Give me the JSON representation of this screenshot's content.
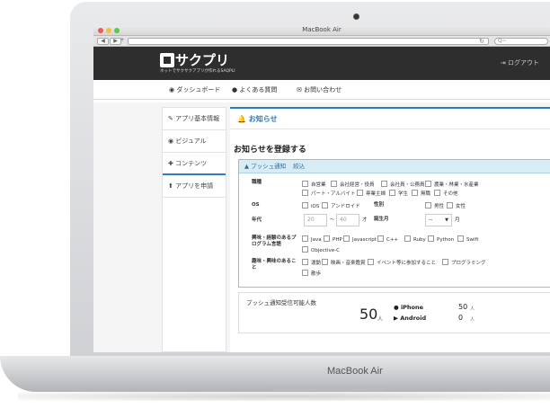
{
  "device": {
    "brand": "MacBook Air"
  },
  "browser": {
    "window_title": "MacBook Air",
    "back_label": "◀",
    "forward_label": "▶",
    "plus_label": "+",
    "reload_label": "↻",
    "search_placeholder": "Q~"
  },
  "header": {
    "logo_text": "サクプリ",
    "logo_sub": "ネットでサクサクアプリが作れるSAQPLI",
    "logout_label": "ログアウト"
  },
  "nav": {
    "items": [
      {
        "label": "ダッシュボード"
      },
      {
        "label": "よくある質問"
      },
      {
        "label": "お問い合わせ"
      }
    ]
  },
  "sidebar": {
    "items": [
      {
        "label": "アプリ基本情報"
      },
      {
        "label": "ビジュアル"
      },
      {
        "label": "コンテンツ"
      },
      {
        "label": "アプリを申請"
      }
    ]
  },
  "main": {
    "tab_label": "お知らせ",
    "page_title": "お知らせを登録する",
    "push": {
      "header_label": "プッシュ通知",
      "filter_label": "絞込",
      "job": {
        "label": "職種",
        "options": [
          "自営業",
          "会社経営・役員",
          "会社員・公務員",
          "農業・林業・水産業",
          "パート・アルバイト",
          "専業主婦",
          "学生",
          "無職",
          "その他"
        ]
      },
      "os": {
        "label": "OS",
        "options": [
          "iOS",
          "アンドロイド"
        ]
      },
      "gender": {
        "label": "性別",
        "options": [
          "男性",
          "女性"
        ]
      },
      "age": {
        "label": "年代",
        "from": "20",
        "tilde": "〜",
        "to": "40",
        "unit": "才"
      },
      "birth_month": {
        "label": "誕生月",
        "select_value": "--",
        "unit": "月"
      },
      "skills": {
        "label": "興味・経験のあるプログラム言語",
        "options": [
          "Java",
          "PHP",
          "Javascript",
          "C++",
          "Ruby",
          "Python",
          "Swift",
          "Objective-C"
        ]
      },
      "interests": {
        "label": "趣味・興味のあること",
        "options": [
          "運動",
          "映画・音楽鑑賞",
          "イベント等に参加すること",
          "プログラミング",
          "散歩"
        ]
      }
    },
    "stats": {
      "title": "プッシュ通知受信可能人数",
      "total": "50",
      "total_unit": "人",
      "iphone_label": "iPhone",
      "iphone_count": "50",
      "android_label": "Android",
      "android_count": "0",
      "unit": "人"
    }
  }
}
